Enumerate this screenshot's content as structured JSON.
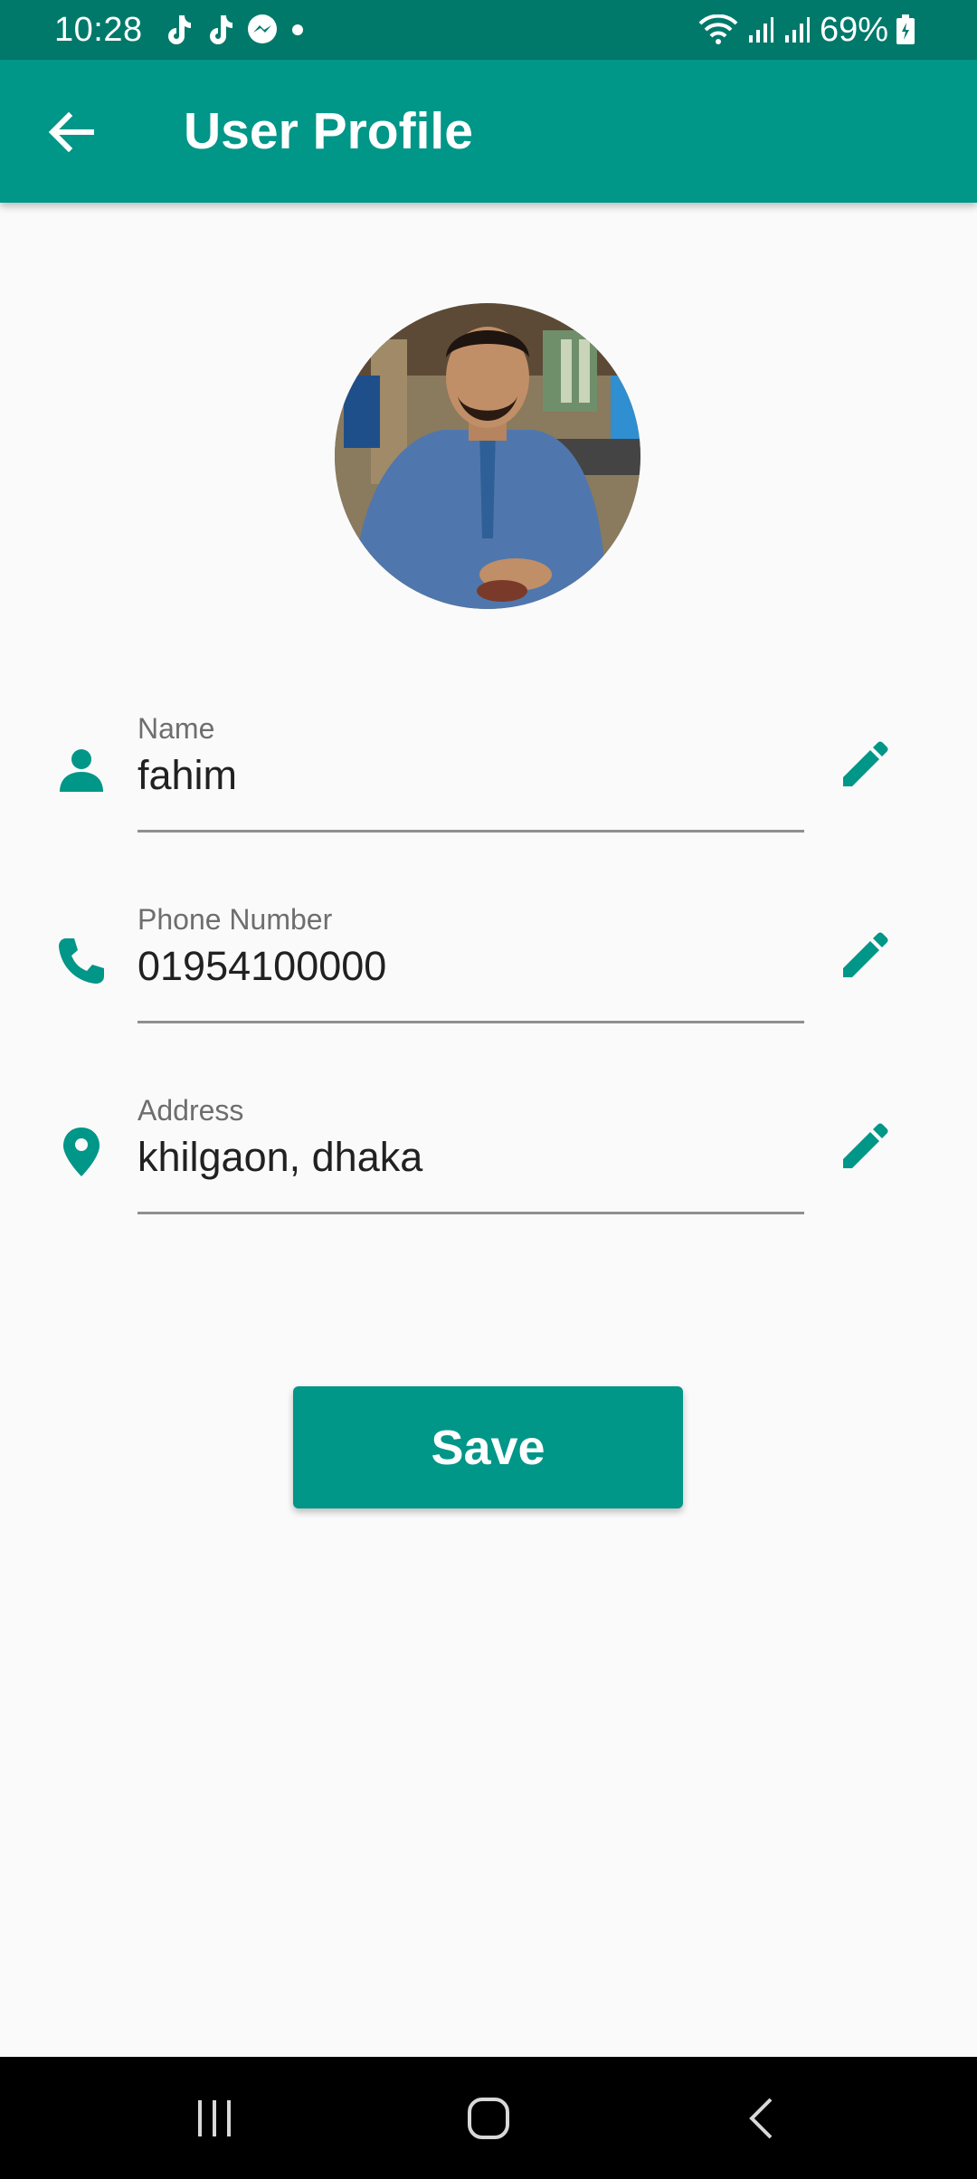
{
  "status_bar": {
    "time": "10:28",
    "battery": "69%",
    "left_icons": [
      "tiktok-icon",
      "tiktok-icon",
      "messenger-icon",
      "dot-icon"
    ],
    "right_icons": [
      "wifi-icon",
      "signal-icon",
      "signal-icon",
      "battery-icon"
    ]
  },
  "app_bar": {
    "title": "User Profile",
    "back_icon": "arrow-back-icon",
    "background": "#009688"
  },
  "profile": {
    "avatar": "user-photo"
  },
  "fields": [
    {
      "label": "Name",
      "value": "fahim",
      "icon": "person-icon",
      "edit_icon": "pencil-icon"
    },
    {
      "label": "Phone Number",
      "value": "01954100000",
      "icon": "phone-icon",
      "edit_icon": "pencil-icon"
    },
    {
      "label": "Address",
      "value": "khilgaon, dhaka",
      "icon": "location-pin-icon",
      "edit_icon": "pencil-icon"
    }
  ],
  "save_button": {
    "label": "Save"
  },
  "nav_bar": {
    "buttons": [
      "recent-apps-icon",
      "home-icon",
      "back-icon"
    ]
  },
  "colors": {
    "primary": "#009688",
    "primary_dark": "#00796b",
    "background": "#fafafa"
  }
}
